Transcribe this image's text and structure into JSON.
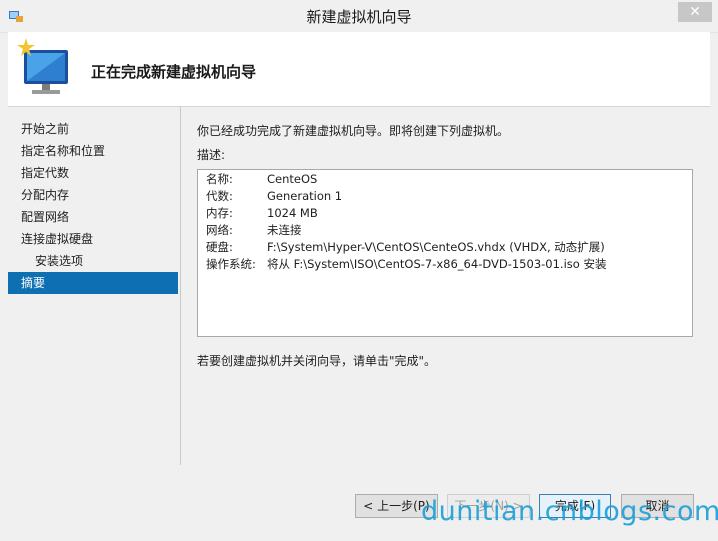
{
  "window": {
    "title": "新建虚拟机向导",
    "close_glyph": "✕"
  },
  "header": {
    "heading": "正在完成新建虚拟机向导"
  },
  "nav": {
    "items": [
      {
        "label": "开始之前"
      },
      {
        "label": "指定名称和位置"
      },
      {
        "label": "指定代数"
      },
      {
        "label": "分配内存"
      },
      {
        "label": "配置网络"
      },
      {
        "label": "连接虚拟硬盘"
      },
      {
        "label": "安装选项"
      },
      {
        "label": "摘要"
      }
    ]
  },
  "main": {
    "intro": "你已经成功完成了新建虚拟机向导。即将创建下列虚拟机。",
    "description_label": "描述:",
    "details": [
      {
        "key": "名称:",
        "value": "CenteOS"
      },
      {
        "key": "代数:",
        "value": "Generation 1"
      },
      {
        "key": "内存:",
        "value": "1024 MB"
      },
      {
        "key": "网络:",
        "value": "未连接"
      },
      {
        "key": "硬盘:",
        "value": "F:\\System\\Hyper-V\\CentOS\\CenteOS.vhdx (VHDX, 动态扩展)"
      },
      {
        "key": "操作系统:",
        "value": "将从 F:\\System\\ISO\\CentOS-7-x86_64-DVD-1503-01.iso 安装"
      }
    ],
    "finish_note": "若要创建虚拟机并关闭向导，请单击\"完成\"。"
  },
  "buttons": {
    "previous": "< 上一步(P)",
    "next": "下一步(N) >",
    "finish": "完成(F)",
    "cancel": "取消"
  },
  "watermark": "dunitian.cnblogs.com",
  "colors": {
    "accent": "#0e6fb2",
    "watermark": "#1a9fd8"
  }
}
